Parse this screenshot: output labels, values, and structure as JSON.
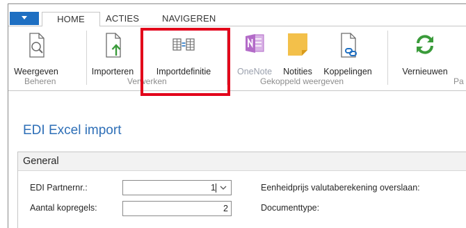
{
  "tabs": {
    "home": "HOME",
    "acties": "ACTIES",
    "navigeren": "NAVIGEREN"
  },
  "ribbon": {
    "buttons": {
      "weergeven": "Weergeven",
      "importeren": "Importeren",
      "importdefinitie": "Importdefinitie",
      "onenote": "OneNote",
      "notities": "Notities",
      "koppelingen": "Koppelingen",
      "vernieuwen": "Vernieuwen"
    },
    "groups": {
      "beheren": "Beheren",
      "verwerken": "Verwerken",
      "gekoppeld": "Gekoppeld weergeven",
      "truncated": "Pa"
    }
  },
  "page": {
    "title": "EDI Excel import",
    "section": "General"
  },
  "fields": {
    "partner_label": "EDI Partnernr.:",
    "partner_value": "1",
    "kopregels_label": "Aantal kopregels:",
    "kopregels_value": "2",
    "eenheidsprijs_label": "Eenheidprijs valutaberekening overslaan:",
    "documenttype_label": "Documenttype:"
  },
  "colors": {
    "accent": "#1e6fc2",
    "title": "#2e6fb7",
    "highlight": "#e2001a",
    "refresh": "#3a9b3a",
    "onenote": "#b36bc8",
    "note": "#f3c04a"
  },
  "icons": {
    "app_menu": "dropdown-triangle",
    "weergeven": "magnifier-document-icon",
    "importeren": "import-arrow-icon",
    "importdefinitie": "table-definition-icon",
    "onenote": "onenote-icon",
    "notities": "sticky-note-icon",
    "koppelingen": "link-document-icon",
    "vernieuwen": "refresh-icon"
  }
}
